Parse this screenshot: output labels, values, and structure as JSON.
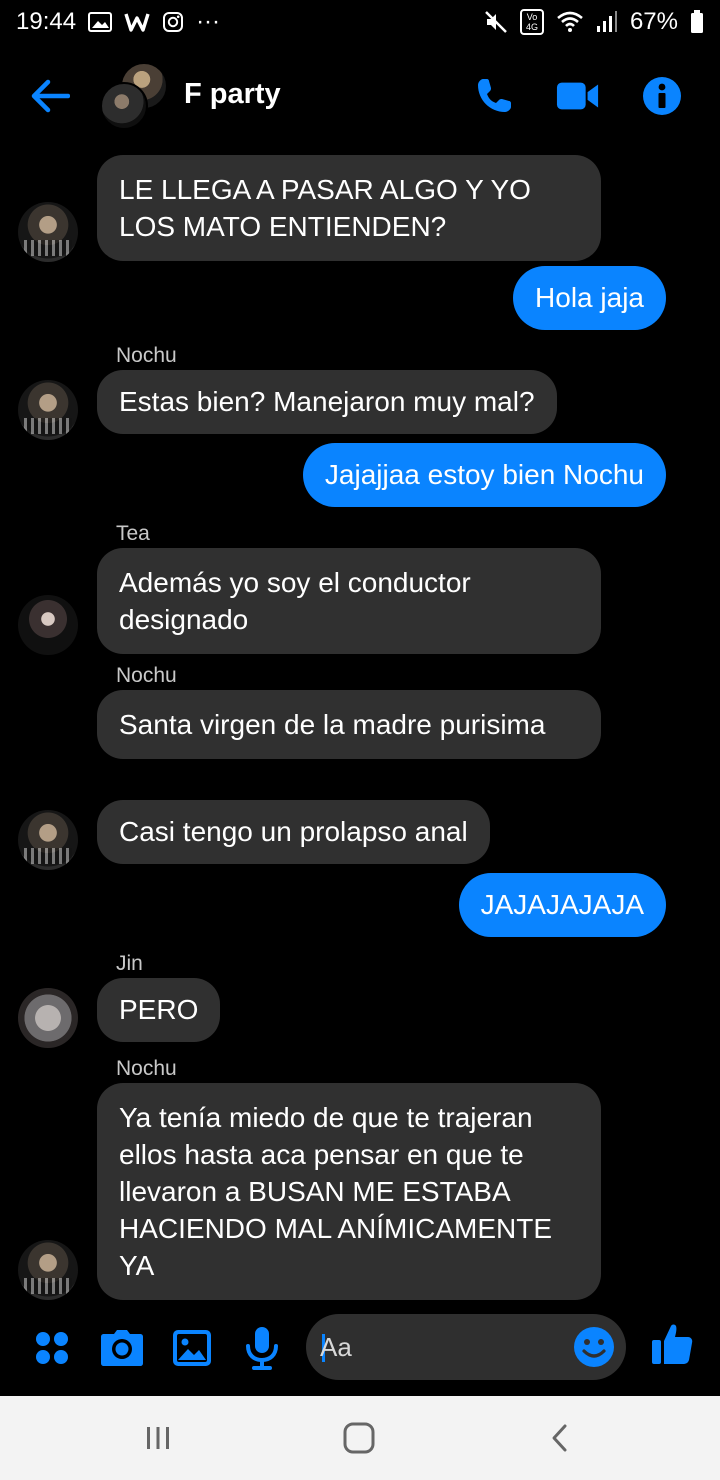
{
  "status_bar": {
    "time": "19:44",
    "more": "···",
    "network": "Vo) 4G",
    "battery": "67%"
  },
  "header": {
    "title": "F party",
    "icons": [
      "back-arrow-icon",
      "phone-icon",
      "video-icon",
      "info-icon"
    ]
  },
  "messages": [
    {
      "type": "in",
      "sender": "",
      "avatar": "nochu",
      "text": "LE LLEGA A PASAR ALGO Y YO LOS MATO ENTIENDEN?"
    },
    {
      "type": "out",
      "text": "Hola jaja"
    },
    {
      "type": "in",
      "sender": "Nochu",
      "avatar": "nochu",
      "text": "Estas bien? Manejaron muy mal?"
    },
    {
      "type": "out",
      "text": "Jajajjaa estoy bien Nochu"
    },
    {
      "type": "in",
      "sender": "Tea",
      "avatar": "tea",
      "text": "Además yo soy el conductor designado"
    },
    {
      "type": "in",
      "sender": "Nochu",
      "avatar": "",
      "text": "Santa virgen de la madre purisima"
    },
    {
      "type": "in",
      "sender": "",
      "avatar": "nochu",
      "text": "Casi tengo un prolapso anal"
    },
    {
      "type": "out",
      "text": "JAJAJAJAJA"
    },
    {
      "type": "in",
      "sender": "Jin",
      "avatar": "jin",
      "text": "PERO"
    },
    {
      "type": "in",
      "sender": "Nochu",
      "avatar": "nochu",
      "text": "Ya tenía miedo de que te trajeran ellos hasta aca pensar en que te llevaron a BUSAN ME ESTABA HACIENDO MAL ANÍMICAMENTE YA"
    }
  ],
  "composer": {
    "placeholder": "Aa",
    "icons": [
      "menu-dots-icon",
      "camera-icon",
      "gallery-icon",
      "microphone-icon",
      "emoji-icon",
      "thumbs-up-icon"
    ]
  },
  "navbar": {
    "icons": [
      "recent-apps-icon",
      "home-icon",
      "back-icon"
    ]
  },
  "colors": {
    "accent": "#0a84ff",
    "incoming_bubble": "#303030",
    "background": "#000000"
  }
}
